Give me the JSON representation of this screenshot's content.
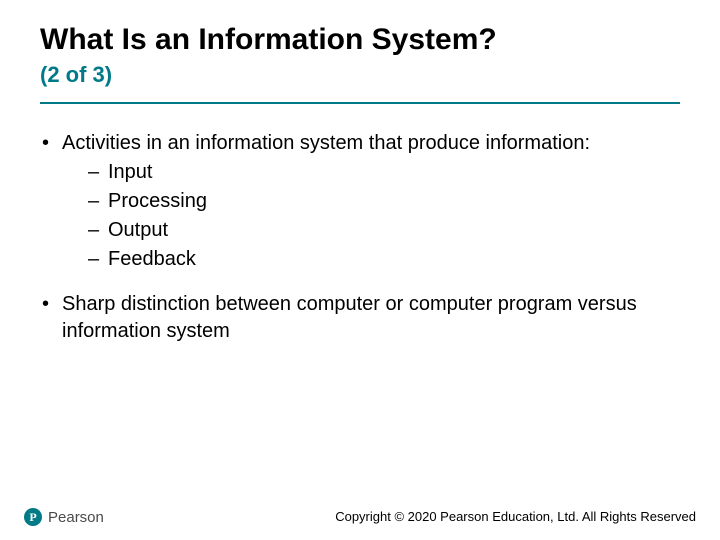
{
  "title": "What Is an Information System?",
  "subtitle": "(2 of 3)",
  "colors": {
    "accent": "#007a87"
  },
  "bullets": {
    "activities_intro": "Activities in an information system that produce information:",
    "activities_items": {
      "0": "Input",
      "1": "Processing",
      "2": "Output",
      "3": "Feedback"
    },
    "distinction": "Sharp distinction between computer or computer program versus information system"
  },
  "logo": {
    "mark_letter": "P",
    "brand": "Pearson"
  },
  "copyright": "Copyright © 2020 Pearson Education, Ltd. All Rights Reserved"
}
